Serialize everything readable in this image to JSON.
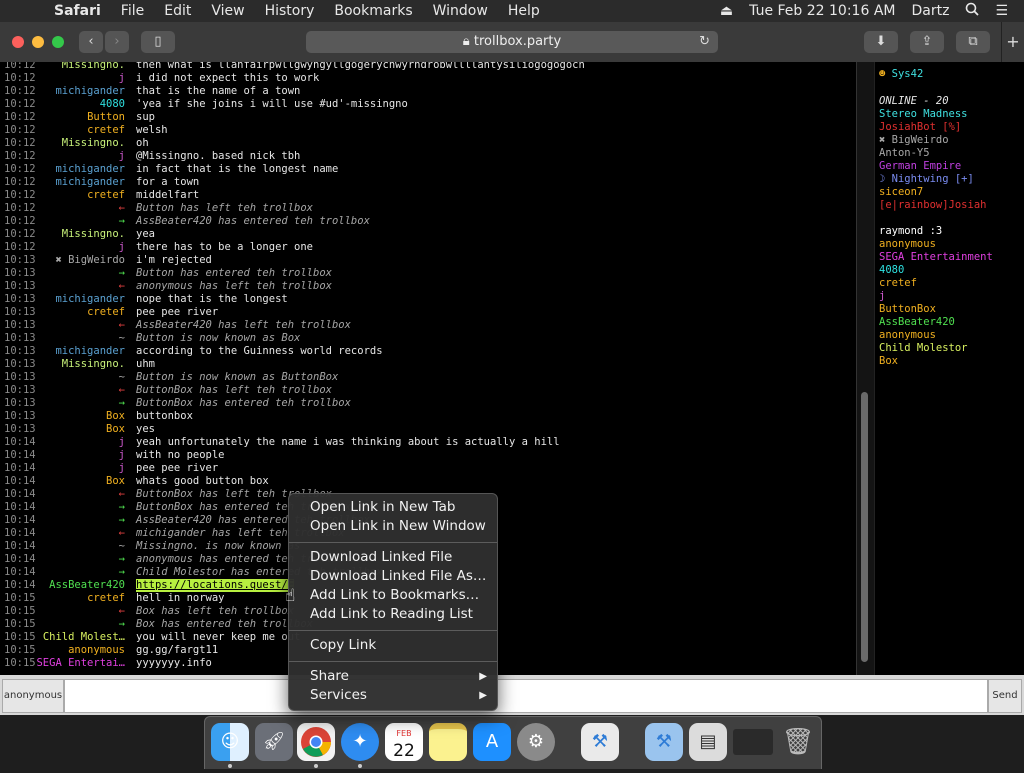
{
  "menubar": {
    "app": "Safari",
    "items": [
      "File",
      "Edit",
      "View",
      "History",
      "Bookmarks",
      "Window",
      "Help"
    ],
    "datetime": "Tue Feb 22  10:16 AM",
    "user": "Dartz"
  },
  "toolbar": {
    "url": "trollbox.party"
  },
  "chat": {
    "rows": [
      {
        "time": "10:12",
        "nick": "Missingno.",
        "nc": "#c8f27a",
        "msg": "then what is llanfairpwllgwyngyllgogerychwyrndrobwllllantysiliogogogoch",
        "sys": false,
        "mc": "#e6e6e6"
      },
      {
        "time": "10:12",
        "nick": "j",
        "nc": "#d05ad0",
        "msg": "i did not expect this to work",
        "sys": false,
        "mc": "#e6e6e6"
      },
      {
        "time": "10:12",
        "nick": "michigander",
        "nc": "#5aa0d0",
        "msg": "that is the name of a town",
        "sys": false,
        "mc": "#e6e6e6"
      },
      {
        "time": "10:12",
        "nick": "4080",
        "nc": "#2ee0e0",
        "msg": "'yea if she joins i will use #ud'-missingno",
        "sys": false,
        "mc": "#e6e6e6"
      },
      {
        "time": "10:12",
        "nick": "Button",
        "nc": "#f0b020",
        "msg": "sup",
        "sys": false,
        "mc": "#e6e6e6"
      },
      {
        "time": "10:12",
        "nick": "cretef",
        "nc": "#f0b020",
        "msg": "welsh",
        "sys": false,
        "mc": "#e6e6e6"
      },
      {
        "time": "10:12",
        "nick": "Missingno.",
        "nc": "#c8f27a",
        "msg": "oh",
        "sys": false,
        "mc": "#e6e6e6"
      },
      {
        "time": "10:12",
        "nick": "j",
        "nc": "#d05ad0",
        "msg": "@Missingno. based nick tbh",
        "sys": false,
        "mc": "#e6e6e6"
      },
      {
        "time": "10:12",
        "nick": "michigander",
        "nc": "#5aa0d0",
        "msg": "in fact that is the longest name",
        "sys": false,
        "mc": "#e6e6e6"
      },
      {
        "time": "10:12",
        "nick": "michigander",
        "nc": "#5aa0d0",
        "msg": "for a town",
        "sys": false,
        "mc": "#e6e6e6"
      },
      {
        "time": "10:12",
        "nick": "cretef",
        "nc": "#f0b020",
        "msg": "middelfart",
        "sys": false,
        "mc": "#e6e6e6"
      },
      {
        "time": "10:12",
        "nick": "←",
        "nc": "#e04040",
        "msg": "Button has left teh trollbox",
        "sys": true,
        "mc": "#a6a6a6"
      },
      {
        "time": "10:12",
        "nick": "→",
        "nc": "#50e050",
        "msg": "AssBeater420 has entered teh trollbox",
        "sys": true,
        "mc": "#a6a6a6"
      },
      {
        "time": "10:12",
        "nick": "Missingno.",
        "nc": "#c8f27a",
        "msg": "yea",
        "sys": false,
        "mc": "#e6e6e6"
      },
      {
        "time": "10:12",
        "nick": "j",
        "nc": "#d05ad0",
        "msg": "there has to be a longer one",
        "sys": false,
        "mc": "#e6e6e6"
      },
      {
        "time": "10:13",
        "nick": "✖ BigWeirdo",
        "nc": "#a8a8a8",
        "msg": "i'm rejected",
        "sys": false,
        "mc": "#e6e6e6"
      },
      {
        "time": "10:13",
        "nick": "→",
        "nc": "#50e050",
        "msg": "Button has entered teh trollbox",
        "sys": true,
        "mc": "#a6a6a6"
      },
      {
        "time": "10:13",
        "nick": "←",
        "nc": "#e04040",
        "msg": "anonymous has left teh trollbox",
        "sys": true,
        "mc": "#a6a6a6"
      },
      {
        "time": "10:13",
        "nick": "michigander",
        "nc": "#5aa0d0",
        "msg": "nope that is the longest",
        "sys": false,
        "mc": "#e6e6e6"
      },
      {
        "time": "10:13",
        "nick": "cretef",
        "nc": "#f0b020",
        "msg": "pee pee river",
        "sys": false,
        "mc": "#e6e6e6"
      },
      {
        "time": "10:13",
        "nick": "←",
        "nc": "#e04040",
        "msg": "AssBeater420 has left teh trollbox",
        "sys": true,
        "mc": "#a6a6a6"
      },
      {
        "time": "10:13",
        "nick": "~",
        "nc": "#a8a8a8",
        "msg": "Button is now known as Box",
        "sys": true,
        "mc": "#a6a6a6"
      },
      {
        "time": "10:13",
        "nick": "michigander",
        "nc": "#5aa0d0",
        "msg": "according to the Guinness world records",
        "sys": false,
        "mc": "#e6e6e6"
      },
      {
        "time": "10:13",
        "nick": "Missingno.",
        "nc": "#c8f27a",
        "msg": "uhm",
        "sys": false,
        "mc": "#e6e6e6"
      },
      {
        "time": "10:13",
        "nick": "~",
        "nc": "#a8a8a8",
        "msg": "Button is now known as ButtonBox",
        "sys": true,
        "mc": "#a6a6a6"
      },
      {
        "time": "10:13",
        "nick": "←",
        "nc": "#e04040",
        "msg": "ButtonBox has left teh trollbox",
        "sys": true,
        "mc": "#a6a6a6"
      },
      {
        "time": "10:13",
        "nick": "→",
        "nc": "#50e050",
        "msg": "ButtonBox has entered teh trollbox",
        "sys": true,
        "mc": "#a6a6a6"
      },
      {
        "time": "10:13",
        "nick": "Box",
        "nc": "#f0b020",
        "msg": "buttonbox",
        "sys": false,
        "mc": "#e6e6e6"
      },
      {
        "time": "10:13",
        "nick": "Box",
        "nc": "#f0b020",
        "msg": "yes",
        "sys": false,
        "mc": "#e6e6e6"
      },
      {
        "time": "10:14",
        "nick": "j",
        "nc": "#d05ad0",
        "msg": "yeah unfortunately the name i was thinking about is actually a hill",
        "sys": false,
        "mc": "#e6e6e6"
      },
      {
        "time": "10:14",
        "nick": "j",
        "nc": "#d05ad0",
        "msg": "with no people",
        "sys": false,
        "mc": "#e6e6e6"
      },
      {
        "time": "10:14",
        "nick": "j",
        "nc": "#d05ad0",
        "msg": "pee pee river",
        "sys": false,
        "mc": "#e6e6e6"
      },
      {
        "time": "10:14",
        "nick": "Box",
        "nc": "#f0b020",
        "msg": "whats good button box",
        "sys": false,
        "mc": "#e6e6e6"
      },
      {
        "time": "10:14",
        "nick": "←",
        "nc": "#e04040",
        "msg": "ButtonBox has left teh trollbox",
        "sys": true,
        "mc": "#a6a6a6"
      },
      {
        "time": "10:14",
        "nick": "→",
        "nc": "#50e050",
        "msg": "ButtonBox has entered teh trollbox",
        "sys": true,
        "mc": "#a6a6a6"
      },
      {
        "time": "10:14",
        "nick": "→",
        "nc": "#50e050",
        "msg": "AssBeater420 has entered teh trollbox",
        "sys": true,
        "mc": "#a6a6a6"
      },
      {
        "time": "10:14",
        "nick": "←",
        "nc": "#e04040",
        "msg": "michigander has left teh trollbox",
        "sys": true,
        "mc": "#a6a6a6"
      },
      {
        "time": "10:14",
        "nick": "~",
        "nc": "#a8a8a8",
        "msg": "Missingno. is now known as",
        "sys": true,
        "mc": "#a6a6a6"
      },
      {
        "time": "10:14",
        "nick": "→",
        "nc": "#50e050",
        "msg": "anonymous has entered teh trollbox",
        "sys": true,
        "mc": "#a6a6a6"
      },
      {
        "time": "10:14",
        "nick": "→",
        "nc": "#50e050",
        "msg": "Child Molestor has entered teh trollbox",
        "sys": true,
        "mc": "#a6a6a6"
      },
      {
        "time": "10:14",
        "nick": "AssBeater420",
        "nc": "#50e050",
        "msg": "https://locations.quest/E",
        "sys": false,
        "mc": "#000000"
      },
      {
        "time": "10:15",
        "nick": "cretef",
        "nc": "#f0b020",
        "msg": "hell in norway",
        "sys": false,
        "mc": "#e6e6e6"
      },
      {
        "time": "10:15",
        "nick": "←",
        "nc": "#e04040",
        "msg": "Box has left teh trollbox",
        "sys": true,
        "mc": "#a6a6a6"
      },
      {
        "time": "10:15",
        "nick": "→",
        "nc": "#50e050",
        "msg": "Box has entered teh trollbox",
        "sys": true,
        "mc": "#a6a6a6"
      },
      {
        "time": "10:15",
        "nick": "Child Molest…",
        "nc": "#d8f060",
        "msg": "you will never keep me out",
        "sys": false,
        "mc": "#e6e6e6"
      },
      {
        "time": "10:15",
        "nick": "anonymous",
        "nc": "#f0b020",
        "msg": "gg.gg/fargt11",
        "sys": false,
        "mc": "#e6e6e6"
      },
      {
        "time": "10:15",
        "nick": "SEGA Entertai…",
        "nc": "#e040e0",
        "msg": "yyyyyyy.info",
        "sys": false,
        "mc": "#e6e6e6"
      }
    ]
  },
  "users": {
    "top": "Sys42",
    "online_label": "ONLINE - 20",
    "list": [
      {
        "name": "Stereo Madness",
        "color": "#40e0e0"
      },
      {
        "name": "JosiahBot [%]",
        "color": "#e03030"
      },
      {
        "name": "✖ BigWeirdo",
        "color": "#a8a8a8"
      },
      {
        "name": "Anton-Y5",
        "color": "#a8a8a8"
      },
      {
        "name": "German Empire",
        "color": "#c040e0"
      },
      {
        "name": "☽ Nightwing [+]",
        "color": "#7a8cf0"
      },
      {
        "name": "siceon7",
        "color": "#f0b020"
      },
      {
        "name": "[e|rainbow]Josiah",
        "color": "#e03030"
      },
      {
        "name": "raymond :3",
        "color": "#ffffff"
      },
      {
        "name": "anonymous",
        "color": "#f0b020"
      },
      {
        "name": "SEGA Entertainment",
        "color": "#e040e0"
      },
      {
        "name": "4080",
        "color": "#2ee0e0"
      },
      {
        "name": "cretef",
        "color": "#f0b020"
      },
      {
        "name": "j",
        "color": "#d05ad0"
      },
      {
        "name": "ButtonBox",
        "color": "#f0b020"
      },
      {
        "name": "AssBeater420",
        "color": "#50e050"
      },
      {
        "name": "anonymous",
        "color": "#f0b020"
      },
      {
        "name": "Child Molestor",
        "color": "#d8f060"
      },
      {
        "name": "Box",
        "color": "#f0b020"
      }
    ]
  },
  "input": {
    "nick": "anonymous",
    "send_label": "Send"
  },
  "context_menu": {
    "items": [
      "Open Link in New Tab",
      "Open Link in New Window",
      "Download Linked File",
      "Download Linked File As…",
      "Add Link to Bookmarks…",
      "Add Link to Reading List",
      "Copy Link",
      "Share",
      "Services"
    ]
  },
  "dock": {
    "icons": [
      "finder-icon",
      "launchpad-icon",
      "chrome-icon",
      "safari-icon",
      "calendar-icon",
      "notes-icon",
      "app-store-icon",
      "system-preferences-icon",
      "xcode-icon",
      "xcode-folder-icon",
      "preview-icon",
      "chrome-window-icon",
      "trash-icon"
    ],
    "calendar_month": "FEB",
    "calendar_day": "22"
  }
}
